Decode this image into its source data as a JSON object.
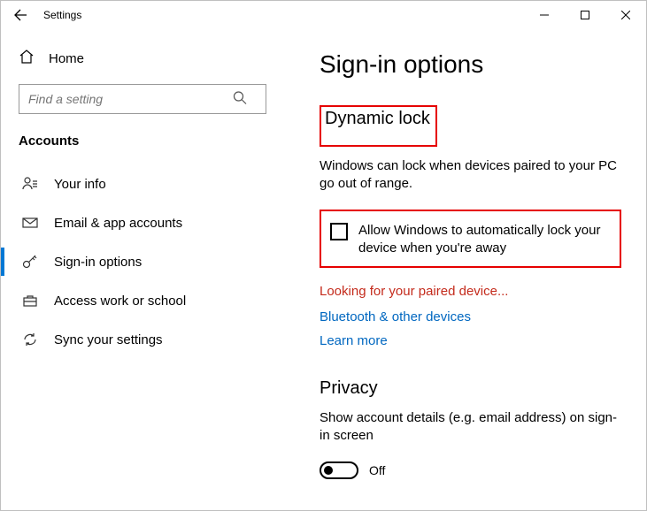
{
  "window": {
    "title": "Settings"
  },
  "home_label": "Home",
  "search": {
    "placeholder": "Find a setting"
  },
  "section_label": "Accounts",
  "nav": {
    "your_info": "Your info",
    "email_app": "Email & app accounts",
    "signin": "Sign-in options",
    "work_school": "Access work or school",
    "sync": "Sync your settings"
  },
  "page": {
    "title": "Sign-in options",
    "dynamic_lock_heading": "Dynamic lock",
    "dynamic_lock_desc": "Windows can lock when devices paired to your PC go out of range.",
    "dynamic_lock_checkbox": "Allow Windows to automatically lock your device when you're away",
    "pairing_status": "Looking for your paired device...",
    "bluetooth_link": "Bluetooth & other devices",
    "learn_more": "Learn more",
    "privacy_heading": "Privacy",
    "privacy_desc": "Show account details (e.g. email address) on sign-in screen",
    "privacy_toggle_state": "Off"
  }
}
